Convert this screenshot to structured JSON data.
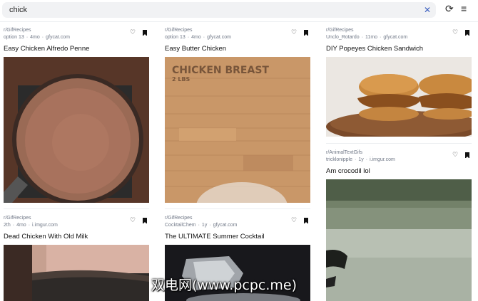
{
  "search": {
    "value": "chick"
  },
  "icons": {
    "clear": "✕",
    "refresh": "⟳",
    "menu": "≡",
    "heart": "♡"
  },
  "cards": [
    {
      "subreddit": "r/GifRecipes",
      "author": "option 13",
      "age": "4mo",
      "domain": "gfycat.com",
      "title": "Easy Chicken Alfredo Penne"
    },
    {
      "subreddit": "r/GifRecipes",
      "author": "option 13",
      "age": "4mo",
      "domain": "gfycat.com",
      "title": "Easy Butter Chicken",
      "overlay_text": "CHICKEN BREAST",
      "overlay_sub": "2 LBS"
    },
    {
      "subreddit": "r/GifRecipes",
      "author": "Unclo_Rotardo",
      "age": "11mo",
      "domain": "gfycat.com",
      "title": "DIY Popeyes Chicken Sandwich"
    },
    {
      "subreddit": "r/AnimalTextGifs",
      "author": "tricklonipple",
      "age": "1y",
      "domain": "i.imgur.com",
      "title": "Am crocodil lol"
    },
    {
      "subreddit": "r/GifRecipes",
      "author": "2th",
      "age": "4mo",
      "domain": "i.imgur.com",
      "title": "Dead Chicken With Old Milk"
    },
    {
      "subreddit": "r/GifRecipes",
      "author": "CocktailChem",
      "age": "1y",
      "domain": "gfycat.com",
      "title": "The ULTIMATE Summer Cocktail"
    }
  ],
  "watermark": "双电网(www.pcpc.me)"
}
